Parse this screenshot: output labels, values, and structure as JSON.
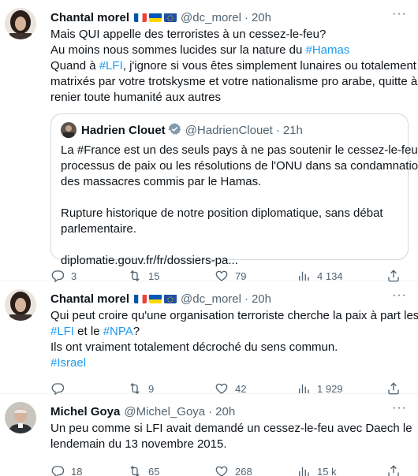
{
  "tweets": [
    {
      "name": "Chantal morel",
      "handle": "@dc_morel",
      "dot": "·",
      "time": "20h",
      "lines": [
        [
          {
            "t": "Mais QUI appelle des terroristes à un cessez-le-feu?"
          }
        ],
        [
          {
            "t": "Au moins nous sommes lucides sur la nature du "
          },
          {
            "t": "#Hamas",
            "hl": true
          }
        ],
        [
          {
            "t": "Quand à "
          },
          {
            "t": "#LFI",
            "hl": true
          },
          {
            "t": ", j'ignore si vous êtes simplement lunaires ou totalement"
          }
        ],
        [
          {
            "t": "matrixés par votre trotskysme et votre nationalisme pro arabe, quitte à"
          }
        ],
        [
          {
            "t": "renier toute humanité aux autres"
          }
        ]
      ],
      "quote": {
        "name": "Hadrien Clouet",
        "handle": "@HadrienClouet",
        "dot": "·",
        "time": "21h",
        "lines": [
          "La #France est un des seuls pays à ne pas soutenir le cessez-le-feu, le",
          "processus de paix ou les résolutions de l'ONU dans sa condamnation",
          "des massacres commis par le Hamas.",
          "",
          "Rupture historique de notre position diplomatique, sans débat",
          "parlementaire.",
          "",
          "diplomatie.gouv.fr/fr/dossiers-pa..."
        ]
      },
      "stats": {
        "replies": "3",
        "retweets": "15",
        "likes": "79",
        "views": "4 134"
      }
    },
    {
      "name": "Chantal morel",
      "handle": "@dc_morel",
      "dot": "·",
      "time": "20h",
      "lines": [
        [
          {
            "t": "Qui peut croire qu'une organisation terroriste cherche la paix à part les"
          }
        ],
        [
          {
            "t": "#LFI",
            "hl": true
          },
          {
            "t": " et le "
          },
          {
            "t": "#NPA",
            "hl": true
          },
          {
            "t": "?"
          }
        ],
        [
          {
            "t": "Ils ont vraiment totalement décroché du sens commun."
          }
        ],
        [
          {
            "t": "#Israel",
            "hl": true
          }
        ]
      ],
      "stats": {
        "replies": "",
        "retweets": "9",
        "likes": "42",
        "views": "1 929"
      }
    },
    {
      "name": "Michel Goya",
      "handle": "@Michel_Goya",
      "dot": "·",
      "time": "20h",
      "lines": [
        [
          {
            "t": "Un peu comme si LFI avait demandé un cessez-le-feu avec Daech le"
          }
        ],
        [
          {
            "t": "lendemain du 13 novembre 2015."
          }
        ]
      ],
      "stats": {
        "replies": "18",
        "retweets": "65",
        "likes": "268",
        "views": "15 k"
      }
    }
  ],
  "more_glyph": "···",
  "colors": {
    "accent": "#1d9bf0",
    "muted": "#536471",
    "border": "#cfd9de"
  },
  "icons": [
    "reply-icon",
    "retweet-icon",
    "like-icon",
    "views-icon",
    "share-icon",
    "verified-icon",
    "more-icon"
  ]
}
